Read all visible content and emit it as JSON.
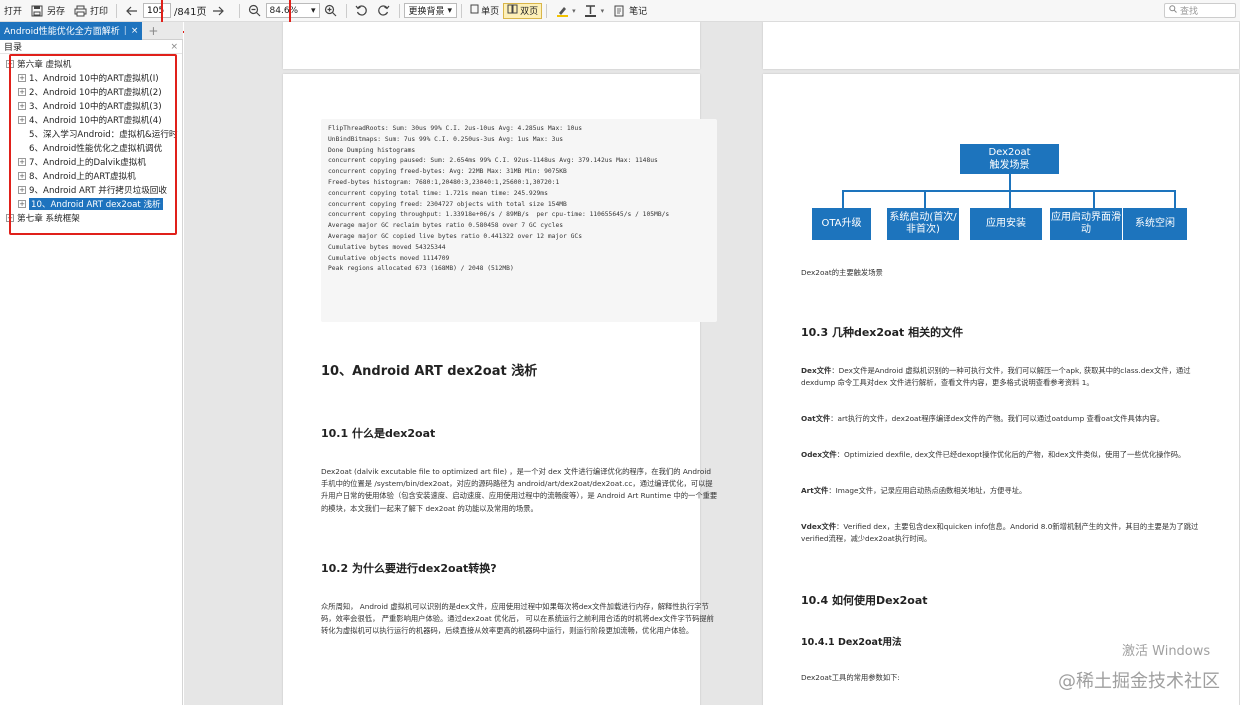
{
  "toolbar": {
    "open": "打开",
    "save_as": "另存",
    "print": "打印",
    "page_current": "105",
    "page_total": "/841页",
    "zoom": "84.6%",
    "background": "更换背景",
    "single": "单页",
    "double": "双页",
    "notes": "笔记",
    "search_placeholder": "查找"
  },
  "tab": {
    "title": "Android性能优化全方面解析"
  },
  "sidebar": {
    "header": "目录",
    "close": "×",
    "toc": [
      {
        "label": "第六章 虚拟机",
        "level": 0,
        "expand": "⊟"
      },
      {
        "label": "1、Android 10中的ART虚拟机(I)",
        "level": 1,
        "expand": "⊞"
      },
      {
        "label": "2、Android 10中的ART虚拟机(2)",
        "level": 1,
        "expand": "⊞"
      },
      {
        "label": "3、Android 10中的ART虚拟机(3)",
        "level": 1,
        "expand": "⊞"
      },
      {
        "label": "4、Android 10中的ART虚拟机(4)",
        "level": 1,
        "expand": "⊞"
      },
      {
        "label": "5、深入学习Android：虚拟机&运行时",
        "level": 1,
        "expand": ""
      },
      {
        "label": "6、Android性能优化之虚拟机调优",
        "level": 1,
        "expand": ""
      },
      {
        "label": "7、Android上的Dalvik虚拟机",
        "level": 1,
        "expand": "⊞"
      },
      {
        "label": "8、Android上的ART虚拟机",
        "level": 1,
        "expand": "⊞"
      },
      {
        "label": "9、Android ART 并行拷贝垃圾回收",
        "level": 1,
        "expand": "⊞"
      },
      {
        "label": "10、Android ART dex2oat 浅析",
        "level": 1,
        "expand": "⊞",
        "selected": true
      },
      {
        "label": "第七章 系统框架",
        "level": 0,
        "expand": "⊞"
      }
    ]
  },
  "left_page": {
    "code_lines": [
      "FlipThreadRoots: Sum: 30us 99% C.I. 2us-10us Avg: 4.285us Max: 10us",
      "UnBindBitmaps: Sum: 7us 99% C.I. 0.250us-3us Avg: 1us Max: 3us",
      "Done Dumping histograms",
      "concurrent copying paused: Sum: 2.654ms 99% C.I. 92us-1148us Avg: 379.142us Max: 1148us",
      "concurrent copying freed-bytes: Avg: 22MB Max: 31MB Min: 9075KB",
      "Freed-bytes histogram: 7680:1,20480:3,23040:1,25600:1,30720:1",
      "concurrent copying total time: 1.721s mean time: 245.929ms",
      "concurrent copying freed: 2304727 objects with total size 154MB",
      "concurrent copying throughput: 1.33918e+06/s / 89MB/s  per cpu-time: 110655645/s / 105MB/s",
      "Average major GC reclaim bytes ratio 0.580458 over 7 GC cycles",
      "Average major GC copied live bytes ratio 0.441322 over 12 major GCs",
      "Cumulative bytes moved 54325344",
      "Cumulative objects moved 1114709",
      "Peak regions allocated 673 (168MB) / 2048 (512MB)"
    ],
    "h_main": "10、Android ART dex2oat 浅析",
    "h_101": "10.1 什么是dex2oat",
    "p_101": "Dex2oat (dalvik excutable file to optimized art file) ，是一个对 dex 文件进行编译优化的程序，在我们的 Android 手机中的位置是 /system/bin/dex2oat，对应的源码路径为 android/art/dex2oat/dex2oat.cc，通过编译优化，可以提升用户日常的使用体验（包含安装速度、启动速度、应用使用过程中的流畅度等），是 Android Art Runtime 中的一个重要的模块，本文我们一起来了解下 dex2oat 的功能以及常用的场景。",
    "h_102": "10.2 为什么要进行dex2oat转换?",
    "p_102": "众所周知， Android 虚拟机可以识别的是dex文件，应用使用过程中如果每次将dex文件加载进行内存，解释性执行字节码，效率会很低， 严重影响用户体验。通过dex2oat 优化后， 可以在系统运行之前利用合适的时机将dex文件字节码提前转化为虚拟机可以执行运行的机器码，后续直接从效率更高的机器码中运行，则运行阶段更加流畅，优化用户体验。"
  },
  "right_page": {
    "diagram": {
      "root": "Dex2oat\n触发场景",
      "children": [
        "OTA升级",
        "系统启动(首次/非首次)",
        "应用安装",
        "应用启动界面滑动",
        "系统空闲"
      ]
    },
    "caption": "Dex2oat的主要触发场景",
    "h_103": "10.3 几种dex2oat 相关的文件",
    "items": [
      {
        "term": "Dex文件",
        "text": "：Dex文件是Android 虚拟机识别的一种可执行文件，我们可以解压一个apk, 获取其中的class.dex文件，通过dexdump 命令工具对dex 文件进行解析，查看文件内容，更多格式说明查看参考资料 1。"
      },
      {
        "term": "Oat文件",
        "text": "：art执行的文件，dex2oat程序编译dex文件的产物。我们可以通过oatdump 查看oat文件具体内容。"
      },
      {
        "term": "Odex文件",
        "text": "：Optimizied dexfile, dex文件已经dexopt操作优化后的产物，和dex文件类似，使用了一些优化操作码。"
      },
      {
        "term": "Art文件",
        "text": "：Image文件，记录应用启动热点函数相关地址，方便寻址。"
      },
      {
        "term": "Vdex文件",
        "text": "：Verified dex，主要包含dex和quicken info信息。Andorid 8.0新增机制产生的文件，其目的主要是为了跳过verified流程，减少dex2oat执行时间。"
      }
    ],
    "h_104": "10.4 如何使用Dex2oat",
    "h_1041": "10.4.1 Dex2oat用法",
    "p_1041": "Dex2oat工具的常用参数如下:"
  },
  "overlay": {
    "activate": "激活 Windows",
    "watermark": "@稀土掘金技术社区"
  }
}
